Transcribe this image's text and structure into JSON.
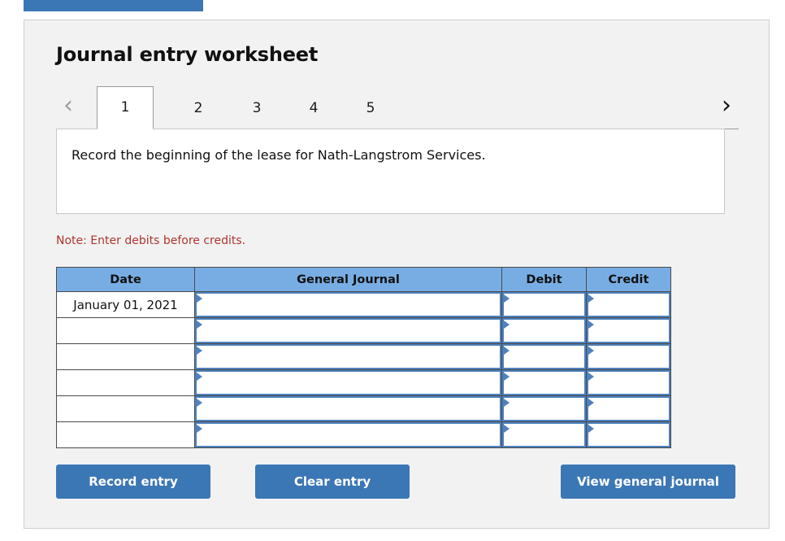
{
  "top_tab": {
    "label": ""
  },
  "panel": {
    "title": "Journal entry worksheet"
  },
  "pager": {
    "prev_icon": "chevron-left-icon",
    "next_icon": "chevron-right-icon",
    "prev_glyph": "‹",
    "next_glyph": "›",
    "active_index": 0,
    "tabs": [
      {
        "label": "1"
      },
      {
        "label": "2"
      },
      {
        "label": "3"
      },
      {
        "label": "4"
      },
      {
        "label": "5"
      }
    ]
  },
  "description": {
    "text": "Record the beginning of the lease for Nath-Langstrom Services."
  },
  "note": {
    "text": "Note: Enter debits before credits."
  },
  "table": {
    "headers": [
      "Date",
      "General Journal",
      "Debit",
      "Credit"
    ],
    "rows": [
      {
        "date": "January 01, 2021",
        "general_journal": "",
        "debit": "",
        "credit": ""
      },
      {
        "date": "",
        "general_journal": "",
        "debit": "",
        "credit": ""
      },
      {
        "date": "",
        "general_journal": "",
        "debit": "",
        "credit": ""
      },
      {
        "date": "",
        "general_journal": "",
        "debit": "",
        "credit": ""
      },
      {
        "date": "",
        "general_journal": "",
        "debit": "",
        "credit": ""
      },
      {
        "date": "",
        "general_journal": "",
        "debit": "",
        "credit": ""
      }
    ]
  },
  "buttons": {
    "record_entry": "Record entry",
    "clear_entry": "Clear entry",
    "view_general_journal": "View general journal"
  },
  "colors": {
    "button_blue": "#3c77b5",
    "header_blue": "#78ade4",
    "field_border_blue": "#4f81bd",
    "note_red": "#b0352d",
    "panel_bg": "#f2f2f2"
  }
}
